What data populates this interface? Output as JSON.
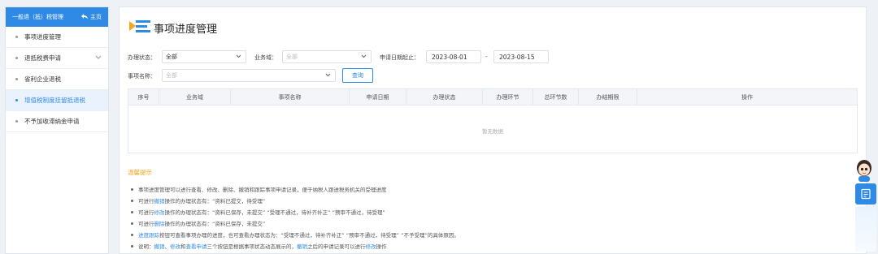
{
  "sidebar": {
    "header_title": "一般退（抵）税管理",
    "home_label": "主页",
    "items": [
      {
        "label": "事项进度管理"
      },
      {
        "label": "退抵税费申请"
      },
      {
        "label": "省利企业退税"
      },
      {
        "label": "增值税制度挂留抵退税"
      },
      {
        "label": "不予加收滞纳金申请"
      }
    ],
    "active_index": 3
  },
  "page": {
    "title": "事项进度管理"
  },
  "filters": {
    "status_label": "办理状态：",
    "status_value": "全部",
    "domain_label": "业务域：",
    "domain_placeholder": "全部",
    "date_label": "申请日期起止：",
    "date_start": "2023-08-01",
    "date_sep": "-",
    "date_end": "2023-08-15",
    "item_label": "事项名称：",
    "item_placeholder": "全部",
    "query_button": "查询"
  },
  "table": {
    "columns": [
      "序号",
      "业务域",
      "事项名称",
      "申请日期",
      "办理状态",
      "办理环节",
      "总环节数",
      "办结期限",
      "操作"
    ],
    "empty_text": "暂无数据"
  },
  "tips": {
    "title": "温馨提示",
    "lines": [
      {
        "parts": [
          {
            "t": "事项进度管理可以进行查看、修改、删除、撤销和跟踪事项申请记录，便于纳税人跟进税务机关的受理进度"
          }
        ]
      },
      {
        "parts": [
          {
            "t": "可进行"
          },
          {
            "t": "撤销",
            "link": true
          },
          {
            "t": "操作的办理状态有：“资料已提交，待受理”"
          }
        ]
      },
      {
        "parts": [
          {
            "t": "可进行"
          },
          {
            "t": "修改",
            "link": true
          },
          {
            "t": "操作的办理状态有：“资料已保存，未提交”  “受理不通过，待补齐补正”  “预审不通过，待受理”"
          }
        ]
      },
      {
        "parts": [
          {
            "t": "可进行"
          },
          {
            "t": "删除",
            "link": true
          },
          {
            "t": "操作的办理状态有：“资料已保存，未提交”"
          }
        ]
      },
      {
        "parts": [
          {
            "t": "进度跟踪",
            "link": true
          },
          {
            "t": "按钮可查看事项办理的进度，也可查看办理状态为：“受理不通过，待补齐补正”  “预审不通过，待受理”  “不予受理”的具体原因。"
          }
        ]
      },
      {
        "parts": [
          {
            "t": "说明："
          },
          {
            "t": "撤销",
            "link": true
          },
          {
            "t": "、"
          },
          {
            "t": "修改",
            "link": true
          },
          {
            "t": "和"
          },
          {
            "t": "查看申请",
            "link": true
          },
          {
            "t": "三个按钮是根据事项状态动态展示的，"
          },
          {
            "t": "撤销",
            "link": true
          },
          {
            "t": "之后的申请记录可以进行"
          },
          {
            "t": "修改",
            "link": true
          },
          {
            "t": "操作"
          }
        ]
      }
    ]
  },
  "colors": {
    "accent": "#2f8ae6",
    "warning": "#f5a623"
  },
  "icons": {
    "home": "back-arrow-icon",
    "chevron": "chevron-down-icon",
    "assistant": "assistant-avatar-icon",
    "float": "document-icon"
  }
}
